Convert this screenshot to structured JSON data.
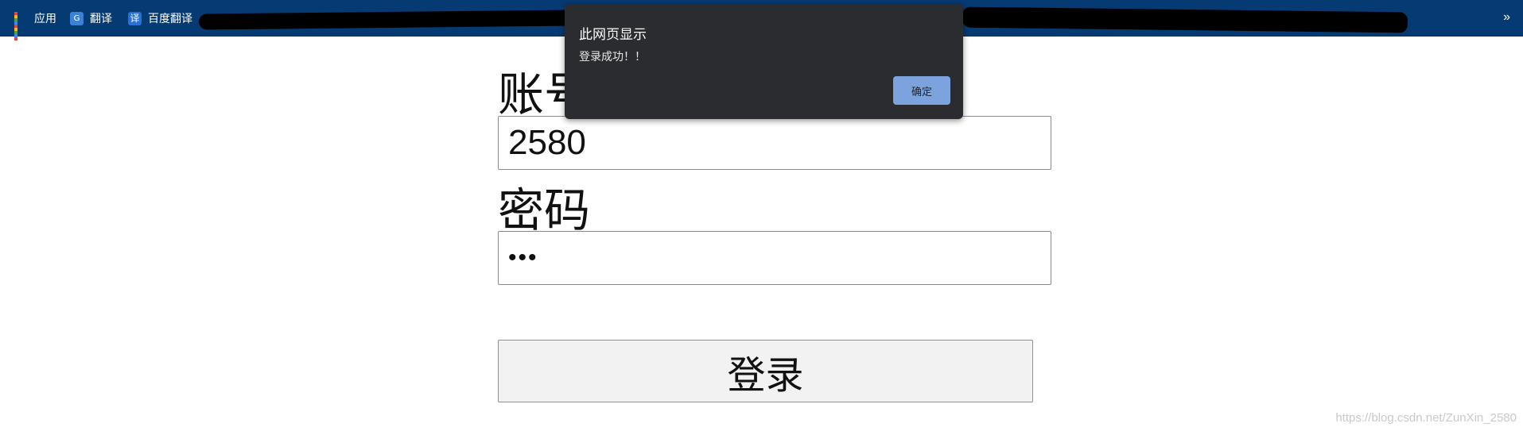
{
  "bookmarks": {
    "items": [
      {
        "label": "应用",
        "icon": "apps-grid-icon"
      },
      {
        "label": "翻译",
        "icon": "translate-icon"
      },
      {
        "label": "百度翻译",
        "icon": "baidu-translate-icon"
      }
    ],
    "overflow_icon": "»"
  },
  "form": {
    "account_label": "账号",
    "account_value": "2580",
    "password_label": "密码",
    "password_masked": "•••",
    "login_label": "登录"
  },
  "alert": {
    "title": "此网页显示",
    "message": "登录成功！！",
    "ok_label": "确定"
  },
  "watermark": "https://blog.csdn.net/ZunXin_2580",
  "colors": {
    "bookmarks_bar": "#063a73",
    "dialog_bg": "#2b2c30",
    "ok_button": "#7ca3de"
  }
}
